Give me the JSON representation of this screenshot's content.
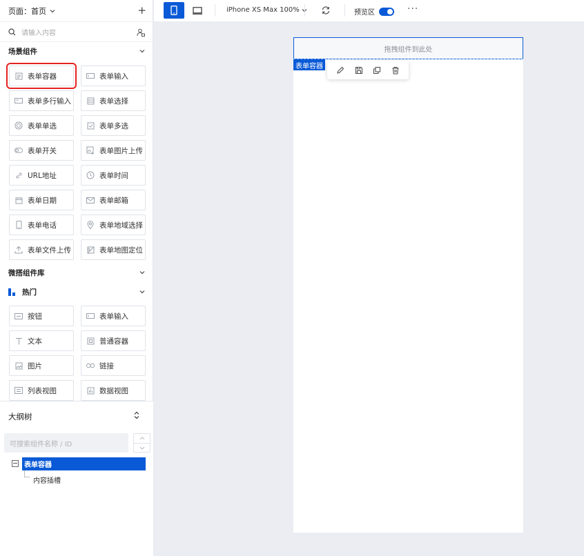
{
  "header": {
    "page_label": "页面：首页"
  },
  "search": {
    "placeholder": "请输入内容"
  },
  "scene_section": {
    "title": "场景组件"
  },
  "scene_components": [
    {
      "label": "表单容器",
      "icon": "form-container-icon"
    },
    {
      "label": "表单输入",
      "icon": "input-icon"
    },
    {
      "label": "表单多行输入",
      "icon": "textarea-icon"
    },
    {
      "label": "表单选择",
      "icon": "select-icon"
    },
    {
      "label": "表单单选",
      "icon": "radio-icon"
    },
    {
      "label": "表单多选",
      "icon": "checkbox-icon"
    },
    {
      "label": "表单开关",
      "icon": "switch-icon"
    },
    {
      "label": "表单图片上传",
      "icon": "image-upload-icon"
    },
    {
      "label": "URL地址",
      "icon": "link-icon"
    },
    {
      "label": "表单时间",
      "icon": "clock-icon"
    },
    {
      "label": "表单日期",
      "icon": "calendar-icon"
    },
    {
      "label": "表单邮箱",
      "icon": "mail-icon"
    },
    {
      "label": "表单电话",
      "icon": "phone-icon"
    },
    {
      "label": "表单地域选择",
      "icon": "location-icon"
    },
    {
      "label": "表单文件上传",
      "icon": "upload-icon"
    },
    {
      "label": "表单地图定位",
      "icon": "map-icon"
    }
  ],
  "lib_section": {
    "title": "微搭组件库"
  },
  "hot_section": {
    "title": "热门"
  },
  "hot_components": [
    {
      "label": "按钮",
      "icon": "button-icon"
    },
    {
      "label": "表单输入",
      "icon": "input-icon"
    },
    {
      "label": "文本",
      "icon": "text-icon"
    },
    {
      "label": "普通容器",
      "icon": "container-icon"
    },
    {
      "label": "图片",
      "icon": "image-icon"
    },
    {
      "label": "链接",
      "icon": "link-icon"
    },
    {
      "label": "列表视图",
      "icon": "list-view-icon"
    },
    {
      "label": "数据视图",
      "icon": "data-view-icon"
    }
  ],
  "outline": {
    "title": "大纲树",
    "search_placeholder": "可搜索组件名称 / ID",
    "root_node": "表单容器",
    "child_node": "内容插槽"
  },
  "toolbar": {
    "device": "iPhone XS Max 100%",
    "preview_label": "预览区",
    "preview_enabled": true,
    "more": "···"
  },
  "canvas": {
    "drop_hint": "拖拽组件到此处",
    "selected_tag": "表单容器"
  },
  "colors": {
    "accent": "#0a5ad7",
    "highlight_box": "#e5221f"
  }
}
